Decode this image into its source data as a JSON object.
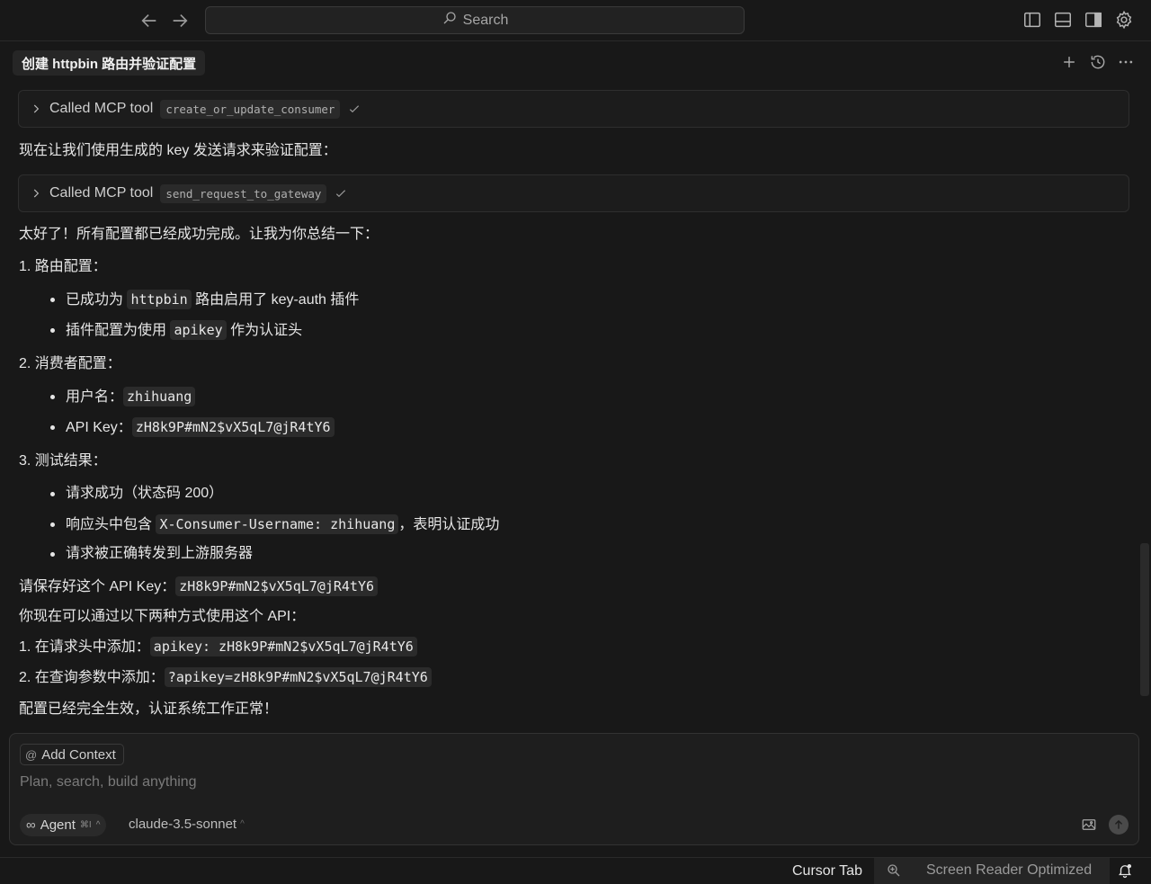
{
  "search": {
    "label": "Search"
  },
  "chat": {
    "title": "创建 httpbin 路由并验证配置"
  },
  "tool_calls": [
    {
      "label": "Called MCP tool",
      "tool": "create_or_update_consumer"
    },
    {
      "label": "Called MCP tool",
      "tool": "send_request_to_gateway"
    }
  ],
  "messages": {
    "intro": "现在让我们使用生成的 key 发送请求来验证配置：",
    "summary": "太好了！所有配置都已经成功完成。让我为你总结一下：",
    "s1_title": "1. 路由配置：",
    "s1_b1_pre": "已成功为 ",
    "s1_b1_code": "httpbin",
    "s1_b1_post": " 路由启用了 key-auth 插件",
    "s1_b2_pre": "插件配置为使用 ",
    "s1_b2_code": "apikey",
    "s1_b2_post": " 作为认证头",
    "s2_title": "2. 消费者配置：",
    "s2_b1_pre": "用户名：",
    "s2_b1_code": "zhihuang",
    "s2_b2_pre": "API Key：",
    "s2_b2_code": "zH8k9P#mN2$vX5qL7@jR4tY6",
    "s3_title": "3. 测试结果：",
    "s3_b1": "请求成功（状态码 200）",
    "s3_b2_pre": "响应头中包含 ",
    "s3_b2_code": "X-Consumer-Username: zhihuang",
    "s3_b2_post": "，表明认证成功",
    "s3_b3": "请求被正确转发到上游服务器",
    "save_pre": "请保存好这个 API Key：",
    "save_code": "zH8k9P#mN2$vX5qL7@jR4tY6",
    "usage": "你现在可以通过以下两种方式使用这个 API：",
    "u1_pre": "1. 在请求头中添加：",
    "u1_code": "apikey: zH8k9P#mN2$vX5qL7@jR4tY6",
    "u2_pre": "2. 在查询参数中添加：",
    "u2_code": "?apikey=zH8k9P#mN2$vX5qL7@jR4tY6",
    "final": "配置已经完全生效，认证系统工作正常！"
  },
  "composer": {
    "add_context": "Add Context",
    "placeholder": "Plan, search, build anything",
    "mode": "Agent",
    "mode_shortcut": "⌘I",
    "model": "claude-3.5-sonnet"
  },
  "status": {
    "cursor_tab": "Cursor Tab",
    "screen_reader": "Screen Reader Optimized"
  }
}
